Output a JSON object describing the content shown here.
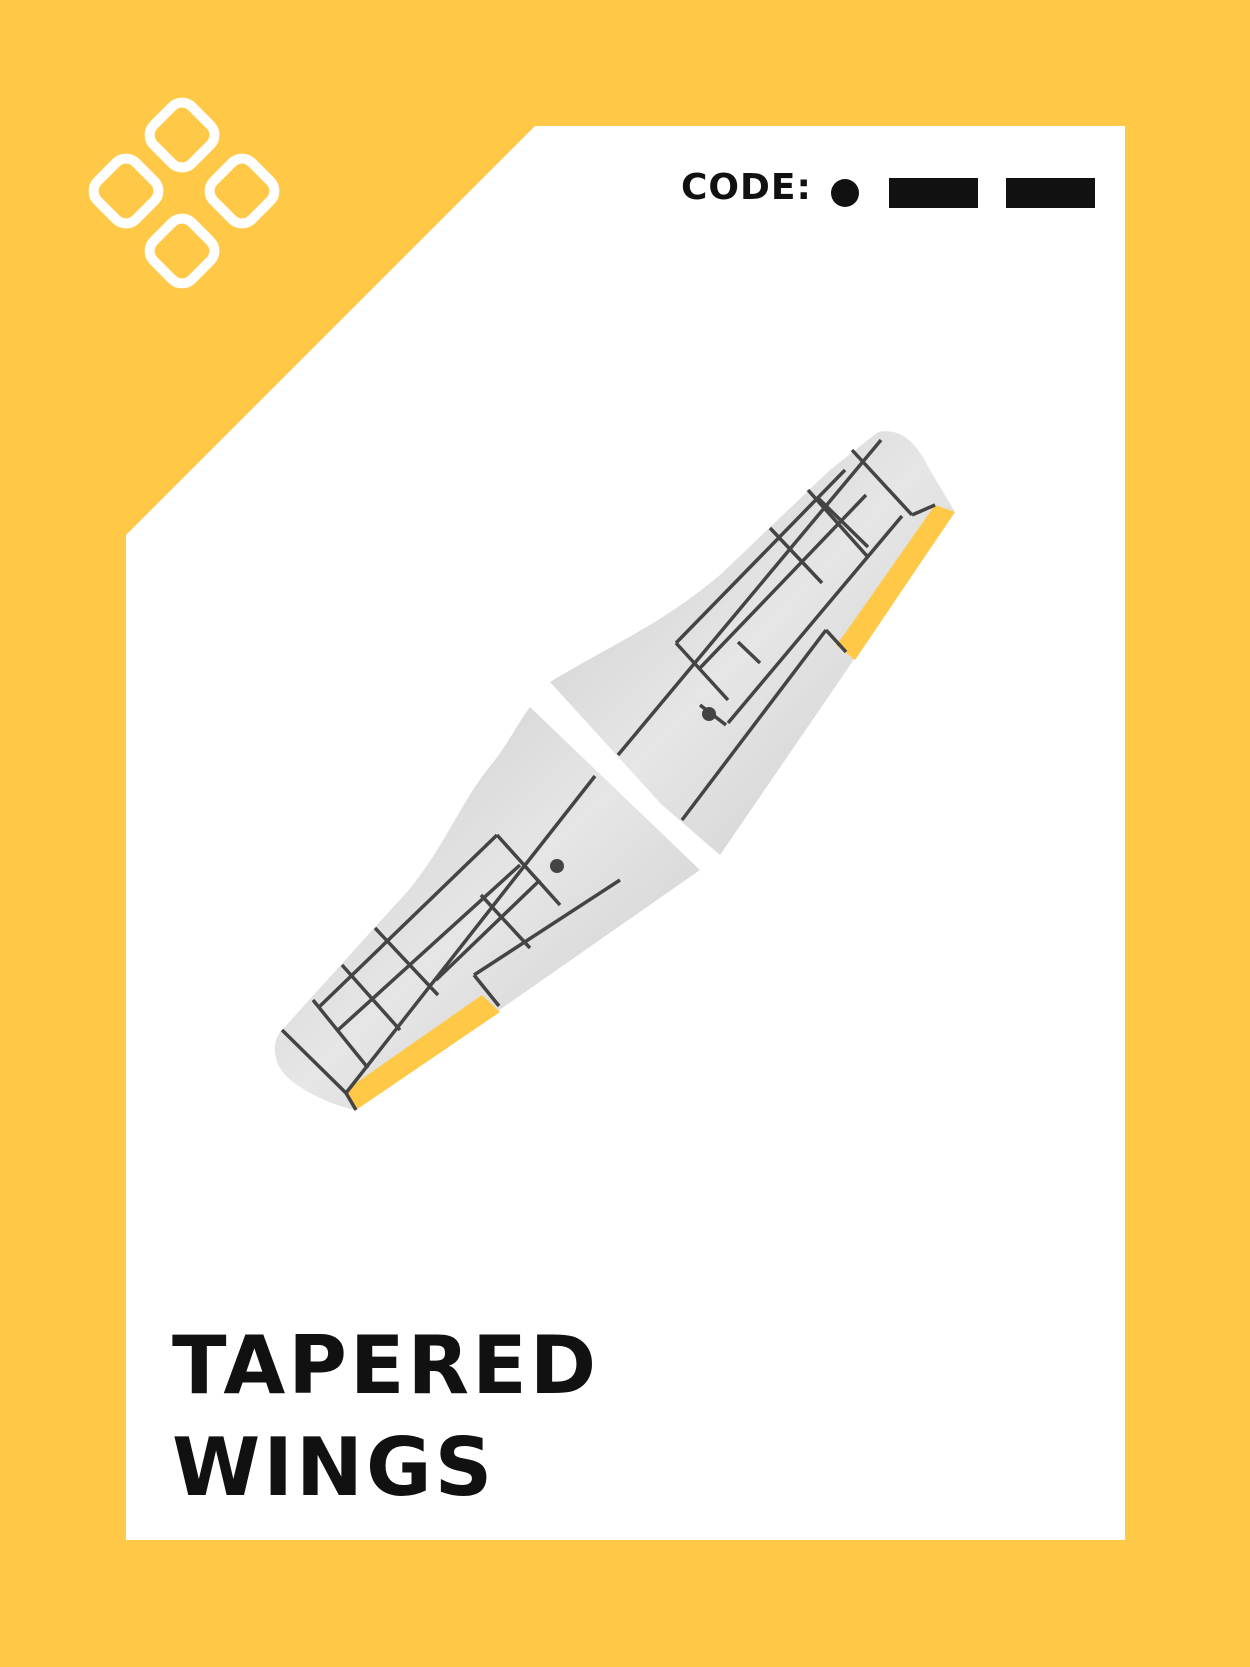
{
  "colors": {
    "card_frame": "#FFC846",
    "card_face": "#FFFFFF",
    "wing_metal": "#D9D9D9",
    "wing_panel_lines": "#444444",
    "control_surface_accent": "#FFC846",
    "ink": "#111111"
  },
  "card": {
    "suit_icon": "four-rounded-squares-icon",
    "code": {
      "label": "CODE:",
      "symbols": [
        "dot",
        "dash",
        "dash"
      ]
    },
    "illustration": "tapered-wings-icon",
    "title_lines": [
      "TAPERED",
      "WINGS"
    ]
  }
}
